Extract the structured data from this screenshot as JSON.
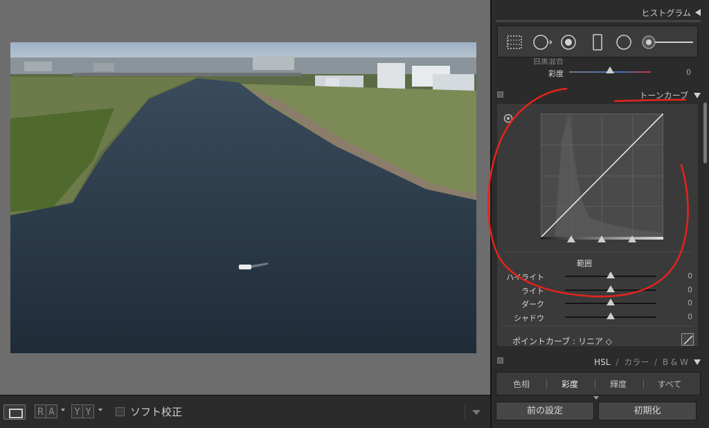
{
  "panel": {
    "histogram": {
      "title": "ヒストグラム"
    },
    "basic_partial": {
      "rows": [
        {
          "label": "彩度",
          "value": "0",
          "thumb": 0.5
        }
      ]
    },
    "tone_curve": {
      "title": "トーンカーブ",
      "range_label": "範囲",
      "sliders": [
        {
          "label": "ハイライト",
          "value": "0",
          "thumb": 0.5
        },
        {
          "label": "ライト",
          "value": "0",
          "thumb": 0.5
        },
        {
          "label": "ダーク",
          "value": "0",
          "thumb": 0.5
        },
        {
          "label": "シャドウ",
          "value": "0",
          "thumb": 0.5
        }
      ],
      "point_curve_label": "ポイントカーブ : リニア ◇"
    },
    "hsl": {
      "header": [
        "HSL",
        "/",
        "カラー",
        "/",
        "B & W"
      ],
      "tabs": [
        "色相",
        "彩度",
        "輝度",
        "すべて"
      ]
    },
    "buttons": {
      "previous": "前の設定",
      "reset": "初期化"
    }
  },
  "toolbar": {
    "ra": [
      "R",
      "A"
    ],
    "yy": [
      "Y",
      "Y"
    ],
    "soft_proof_label": "ソフト校正"
  },
  "colors": {
    "annotation": "#e8231a",
    "panel_bg": "#2b2b2b",
    "workspace_bg": "#6d6d6d"
  }
}
